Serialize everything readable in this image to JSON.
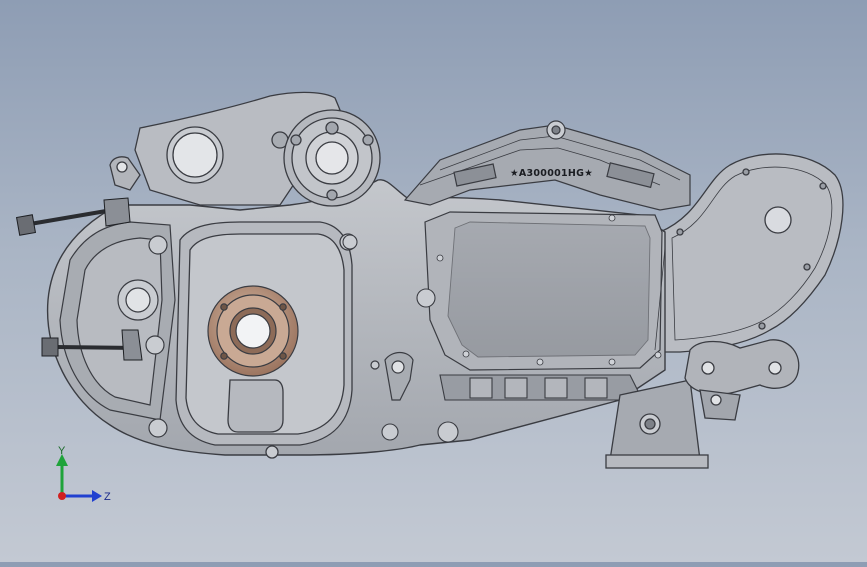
{
  "viewport": {
    "background_top": "#8e9db4",
    "background_bottom": "#c3c9d3"
  },
  "model": {
    "part_color": "#b4b8be",
    "edge_color": "#3a3c42",
    "bronze_bushing_color": "#b48f78",
    "casting_marking": "★A300001HG★"
  },
  "triad": {
    "y_label": "Y",
    "z_label": "Z",
    "y_color": "#1fa33a",
    "z_color": "#2040d0",
    "x_color": "#d02020"
  }
}
